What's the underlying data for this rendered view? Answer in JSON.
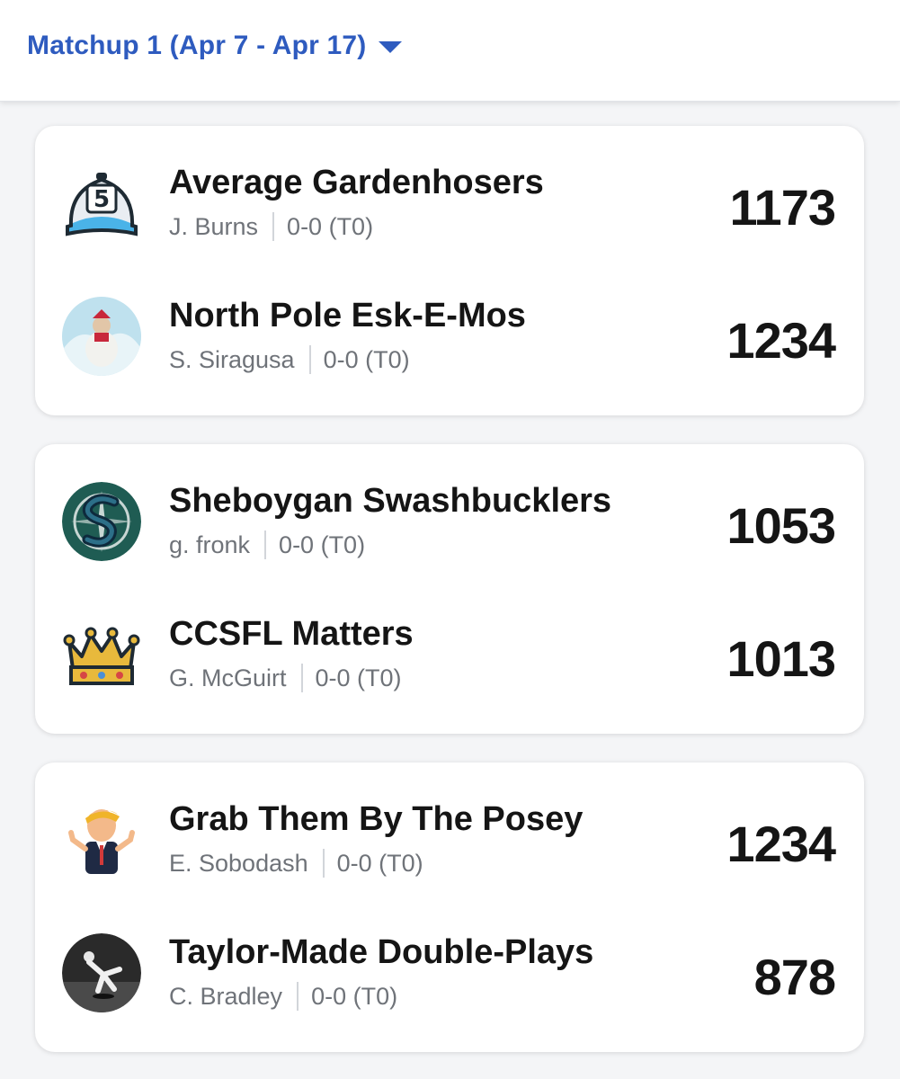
{
  "header": {
    "matchup_label": "Matchup 1 (Apr 7 - Apr 17)"
  },
  "matchups": [
    {
      "teams": [
        {
          "name": "Average Gardenhosers",
          "owner": "J. Burns",
          "record": "0-0 (T0)",
          "score": "1173",
          "avatar": "baseball-cap-5-icon"
        },
        {
          "name": "North Pole Esk-E-Mos",
          "owner": "S. Siragusa",
          "record": "0-0 (T0)",
          "score": "1234",
          "avatar": "polar-bear-photo"
        }
      ]
    },
    {
      "teams": [
        {
          "name": "Sheboygan Swashbucklers",
          "owner": "g. fronk",
          "record": "0-0 (T0)",
          "score": "1053",
          "avatar": "mariners-logo"
        },
        {
          "name": "CCSFL Matters",
          "owner": "G. McGuirt",
          "record": "0-0 (T0)",
          "score": "1013",
          "avatar": "crown-icon"
        }
      ]
    },
    {
      "teams": [
        {
          "name": "Grab Them By The Posey",
          "owner": "E. Sobodash",
          "record": "0-0 (T0)",
          "score": "1234",
          "avatar": "cartoon-man-thumbs-up"
        },
        {
          "name": "Taylor-Made Double-Plays",
          "owner": "C. Bradley",
          "record": "0-0 (T0)",
          "score": "878",
          "avatar": "baseball-player-photo"
        }
      ]
    }
  ],
  "colors": {
    "accent": "#2e5bbf",
    "text_primary": "#151515",
    "text_secondary": "#6f7379",
    "background": "#f4f5f7",
    "card": "#ffffff"
  }
}
